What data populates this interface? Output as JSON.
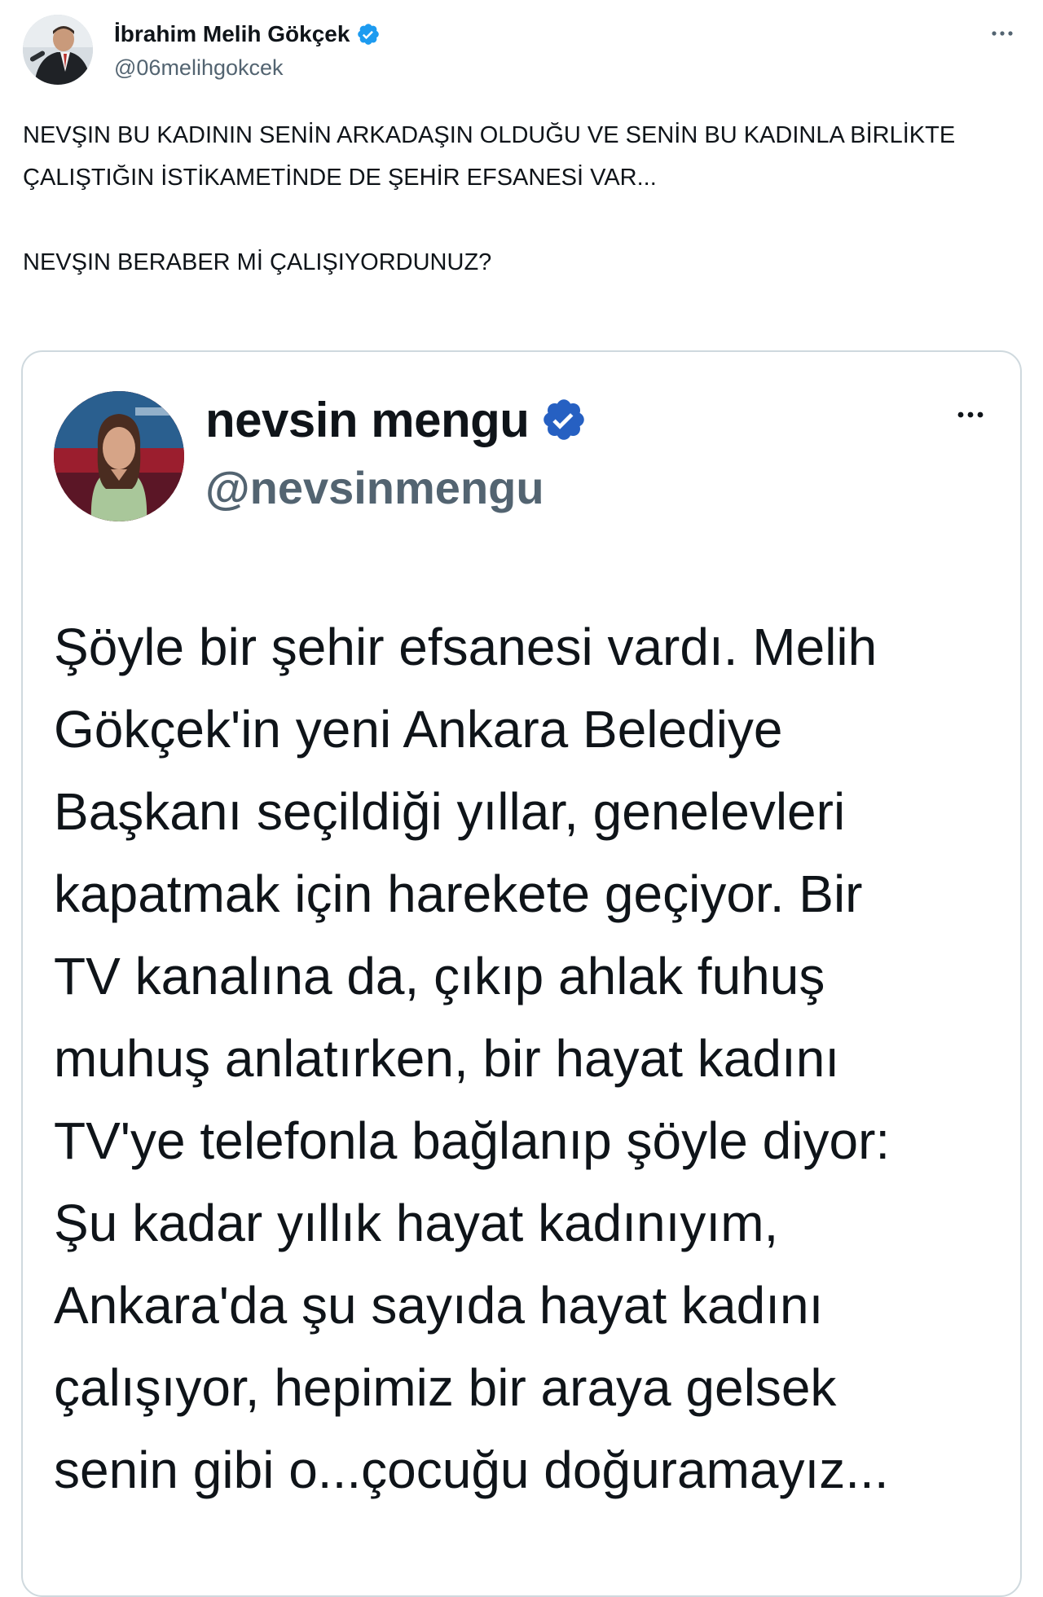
{
  "outer_tweet": {
    "author_name": "İbrahim Melih Gökçek",
    "handle": "@06melihgokcek",
    "verified_icon": "verified-badge-icon",
    "more_icon": "more-options-icon",
    "text_paragraphs": [
      "NEVŞIN BU KADININ SENİN ARKADAŞIN OLDUĞU VE SENİN BU KADINLA BİRLİKTE ÇALIŞTIĞIN İSTİKAMETİNDE DE ŞEHİR EFSANESİ VAR...",
      "NEVŞIN BERABER Mİ ÇALIŞIYORDUNUZ?"
    ]
  },
  "quoted_tweet": {
    "author_name": "nevsin mengu",
    "handle": "@nevsinmengu",
    "verified_icon": "verified-badge-icon",
    "more_icon": "more-options-icon",
    "text_lines": [
      "Şöyle bir şehir efsanesi vardı. Melih",
      "Gökçek'in yeni Ankara Belediye",
      "Başkanı seçildiği yıllar, genelevleri",
      "kapatmak için harekete geçiyor. Bir",
      "TV kanalına da, çıkıp ahlak fuhuş",
      "muhuş anlatırken, bir hayat kadını",
      "TV'ye telefonla bağlanıp şöyle diyor:",
      "Şu kadar yıllık hayat kadınıyım,",
      "Ankara'da şu sayıda hayat kadını",
      "çalışıyor, hepimiz bir araya gelsek",
      "senin gibi o...çocuğu doğuramayız..."
    ]
  },
  "colors": {
    "text_primary": "#0f1419",
    "text_secondary": "#536471",
    "verified_blue": "#1d9bf0",
    "border": "#cfd9de"
  }
}
